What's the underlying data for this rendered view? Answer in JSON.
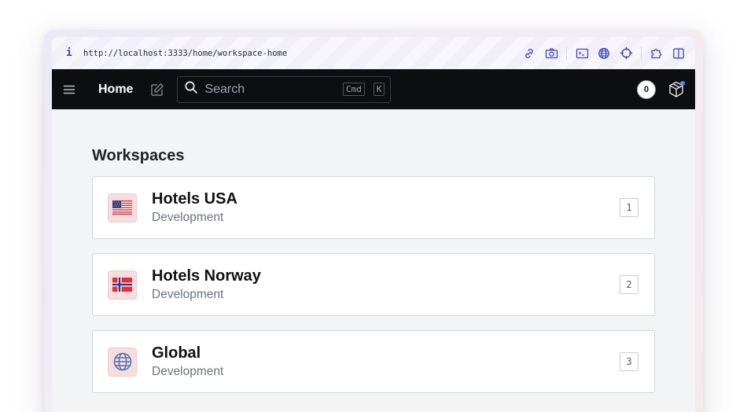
{
  "browser": {
    "url": "http://localhost:3333/home/workspace-home",
    "info_icon": "i",
    "tools": [
      "link-icon",
      "camera-icon",
      "terminal-icon",
      "globe-icon",
      "crosshair-icon",
      "puzzle-icon",
      "split-panel-icon"
    ],
    "accent_color": "#3a46c9"
  },
  "navbar": {
    "title": "Home",
    "search": {
      "placeholder": "Search",
      "shortcut_mod": "Cmd",
      "shortcut_key": "K"
    },
    "notification_count": "0",
    "status_dot_color": "#4f8cf7"
  },
  "main": {
    "section_title": "Workspaces",
    "workspaces": [
      {
        "name": "Hotels USA",
        "environment": "Development",
        "shortcut": "1",
        "icon": "us-flag-icon"
      },
      {
        "name": "Hotels Norway",
        "environment": "Development",
        "shortcut": "2",
        "icon": "norway-flag-icon"
      },
      {
        "name": "Global",
        "environment": "Development",
        "shortcut": "3",
        "icon": "globe-icon"
      }
    ]
  }
}
